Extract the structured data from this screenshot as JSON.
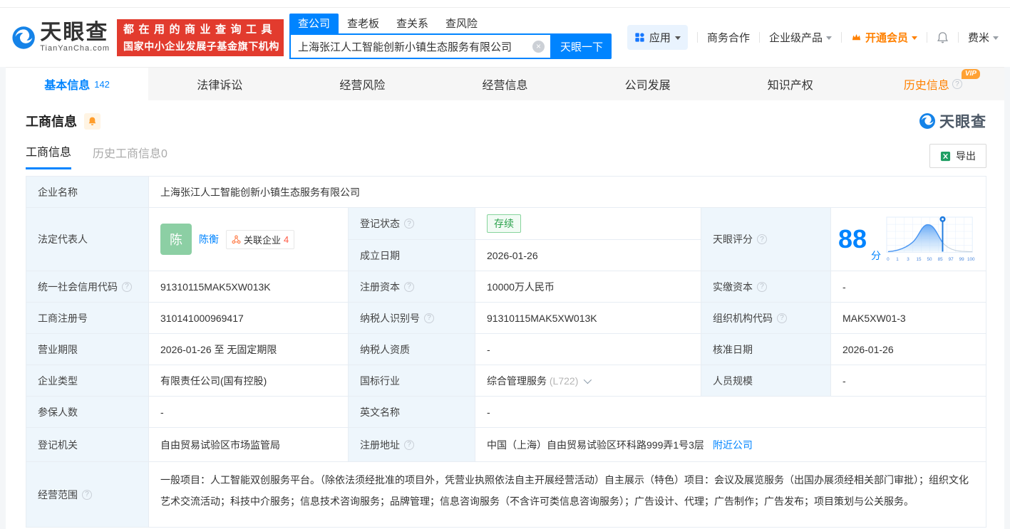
{
  "colors": {
    "accent": "#0084ff",
    "banner_red": "#e23b2e",
    "vip_orange": "#ff8000",
    "status_green": "#2ba24c",
    "link_blue": "#0084ff"
  },
  "icons": {
    "help": "?",
    "clear": "×"
  },
  "header": {
    "logo": {
      "brand": "天眼查",
      "domain": "TianYanCha.com"
    },
    "promo": {
      "line1": "都在用的商业查询工具",
      "line2": "国家中小企业发展子基金旗下机构"
    },
    "search": {
      "tabs": [
        {
          "label": "查公司",
          "active": true
        },
        {
          "label": "查老板",
          "active": false
        },
        {
          "label": "查关系",
          "active": false
        },
        {
          "label": "查风险",
          "active": false
        }
      ],
      "value": "上海张江人工智能创新小镇生态服务有限公司",
      "button_label": "天眼一下"
    },
    "nav": {
      "apps_label": "应用",
      "coop_label": "商务合作",
      "enterprise_label": "企业级产品",
      "vip_label": "开通会员",
      "user_label": "费米"
    }
  },
  "main_tabs": [
    {
      "label": "基本信息",
      "count": "142",
      "active": true
    },
    {
      "label": "法律诉讼"
    },
    {
      "label": "经营风险"
    },
    {
      "label": "经营信息"
    },
    {
      "label": "公司发展"
    },
    {
      "label": "知识产权"
    },
    {
      "label": "历史信息",
      "vip_badge": "VIP"
    }
  ],
  "section": {
    "title": "工商信息",
    "watermark_brand": "天眼查",
    "subtabs": [
      {
        "label": "工商信息",
        "active": true
      },
      {
        "label": "历史工商信息0",
        "active": false
      }
    ],
    "export_label": "导出"
  },
  "fields": {
    "company_name": {
      "label": "企业名称",
      "value": "上海张江人工智能创新小镇生态服务有限公司"
    },
    "legal_rep": {
      "label": "法定代表人",
      "avatar_char": "陈",
      "name": "陈衡",
      "related_label": "关联企业",
      "related_count": "4"
    },
    "reg_status": {
      "label": "登记状态",
      "value": "存续"
    },
    "establish_date": {
      "label": "成立日期",
      "value": "2026-01-26"
    },
    "score": {
      "label": "天眼评分",
      "value": "88",
      "unit": "分",
      "chart": {
        "type": "area",
        "marker_value": 88,
        "tick_labels": [
          "0",
          "1",
          "3",
          "15",
          "50",
          "85",
          "97",
          "99",
          "100"
        ]
      }
    },
    "credit_code": {
      "label": "统一社会信用代码",
      "value": "91310115MAK5XW013K"
    },
    "reg_capital": {
      "label": "注册资本",
      "value": "10000万人民币"
    },
    "paid_capital": {
      "label": "实缴资本",
      "value": "-"
    },
    "reg_number": {
      "label": "工商注册号",
      "value": "310141000969417"
    },
    "taxpayer_id": {
      "label": "纳税人识别号",
      "value": "91310115MAK5XW013K"
    },
    "org_code": {
      "label": "组织机构代码",
      "value": "MAK5XW01-3"
    },
    "business_term": {
      "label": "营业期限",
      "value": "2026-01-26 至 无固定期限"
    },
    "taxpayer_quality": {
      "label": "纳税人资质",
      "value": "-"
    },
    "approval_date": {
      "label": "核准日期",
      "value": "2026-01-26"
    },
    "company_type": {
      "label": "企业类型",
      "value": "有限责任公司(国有控股)"
    },
    "industry": {
      "label": "国标行业",
      "value": "综合管理服务",
      "code": "(L722)"
    },
    "staff_size": {
      "label": "人员规模",
      "value": "-"
    },
    "insured_count": {
      "label": "参保人数",
      "value": "-"
    },
    "english_name": {
      "label": "英文名称",
      "value": "-"
    },
    "reg_authority": {
      "label": "登记机关",
      "value": "自由贸易试验区市场监管局"
    },
    "reg_address": {
      "label": "注册地址",
      "value": "中国（上海）自由贸易试验区环科路999弄1号3层",
      "nearby_link": "附近公司"
    },
    "business_scope": {
      "label": "经营范围",
      "value": "一般项目：人工智能双创服务平台。（除依法须经批准的项目外，凭营业执照依法自主开展经营活动）自主展示（特色）项目：会议及展览服务（出国办展须经相关部门审批）；组织文化艺术交流活动；科技中介服务；信息技术咨询服务；品牌管理；信息咨询服务（不含许可类信息咨询服务）；广告设计、代理；广告制作；广告发布；项目策划与公关服务。"
    }
  }
}
